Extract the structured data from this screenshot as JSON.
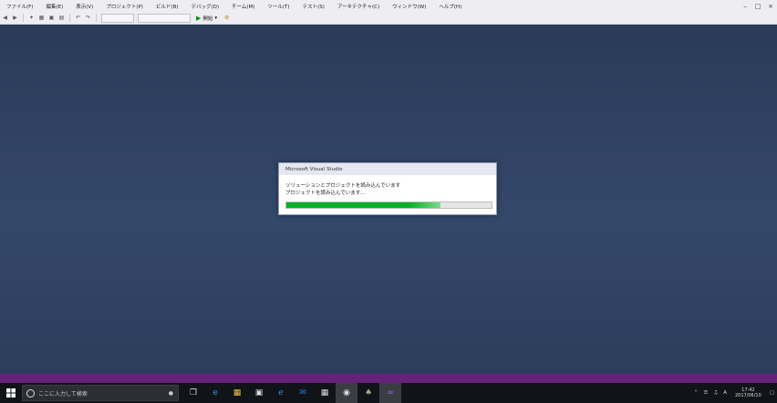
{
  "menubar": {
    "items": [
      "ファイル(F)",
      "編集(E)",
      "表示(V)",
      "プロジェクト(P)",
      "ビルド(B)",
      "デバッグ(D)",
      "チーム(M)",
      "ツール(T)",
      "テスト(S)",
      "アーキテクチャ(C)",
      "ウィンドウ(W)",
      "ヘルプ(H)"
    ]
  },
  "toolbar": {
    "start_label": "開始"
  },
  "dialog": {
    "title": "Microsoft Visual Studio",
    "line1": "ソリューションとプロジェクトを読み込んでいます",
    "line2": "プロジェクトを読み込んでいます...",
    "progress": 0.75
  },
  "taskbar": {
    "search_placeholder": "ここに入力して検索",
    "apps": [
      "task-view",
      "edge",
      "file-explorer",
      "store",
      "ie",
      "outlook",
      "calculator",
      "unreal",
      "game",
      "visual-studio"
    ],
    "clock_time": "17:42",
    "clock_date": "2017/06/10"
  },
  "colors": {
    "vs_purple": "#68217a",
    "progress_green": "#06b025"
  }
}
